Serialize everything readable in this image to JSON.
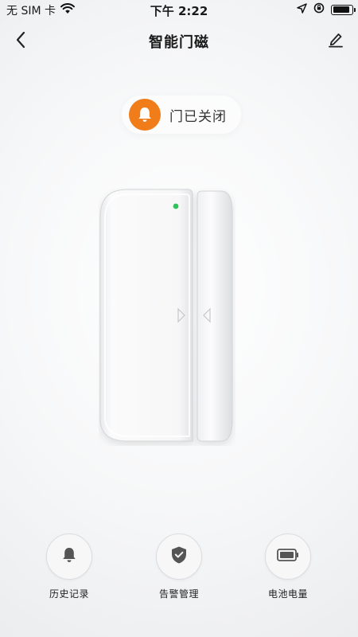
{
  "status_bar": {
    "carrier": "无 SIM 卡",
    "time": "下午 2:22",
    "wifi_icon": "wifi-icon",
    "location_icon": "location-arrow-icon",
    "lock_icon": "orientation-lock-icon",
    "battery_level": 0.9
  },
  "nav": {
    "title": "智能门磁",
    "back_icon": "back-chevron-icon",
    "edit_icon": "pencil-icon"
  },
  "door_status": {
    "label": "门已关闭",
    "icon": "bell-icon",
    "icon_color": "#f07c1a"
  },
  "device": {
    "led_color": "#2fc25b",
    "state": "closed"
  },
  "actions": [
    {
      "label": "历史记录",
      "icon": "bell-icon"
    },
    {
      "label": "告警管理",
      "icon": "shield-check-icon"
    },
    {
      "label": "电池电量",
      "icon": "battery-icon"
    }
  ]
}
